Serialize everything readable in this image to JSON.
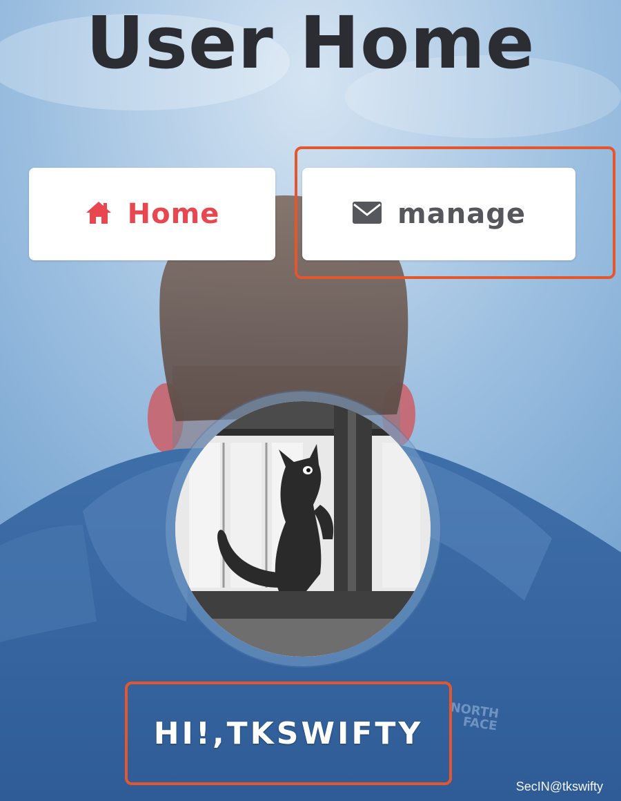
{
  "header": {
    "title": "User Home"
  },
  "nav": {
    "home": {
      "label": "Home",
      "icon": "home-icon",
      "color": "#e8474f"
    },
    "manage": {
      "label": "manage",
      "icon": "envelope-icon",
      "color": "#55575c"
    }
  },
  "profile": {
    "greeting": "HI!,TKSWIFTY"
  },
  "background": {
    "jacket_logo_lines": [
      "NORTH",
      "FACE"
    ]
  },
  "watermark": {
    "text": "SecIN@tkswifty"
  },
  "annotations": {
    "highlight_color": "#e4572e"
  }
}
